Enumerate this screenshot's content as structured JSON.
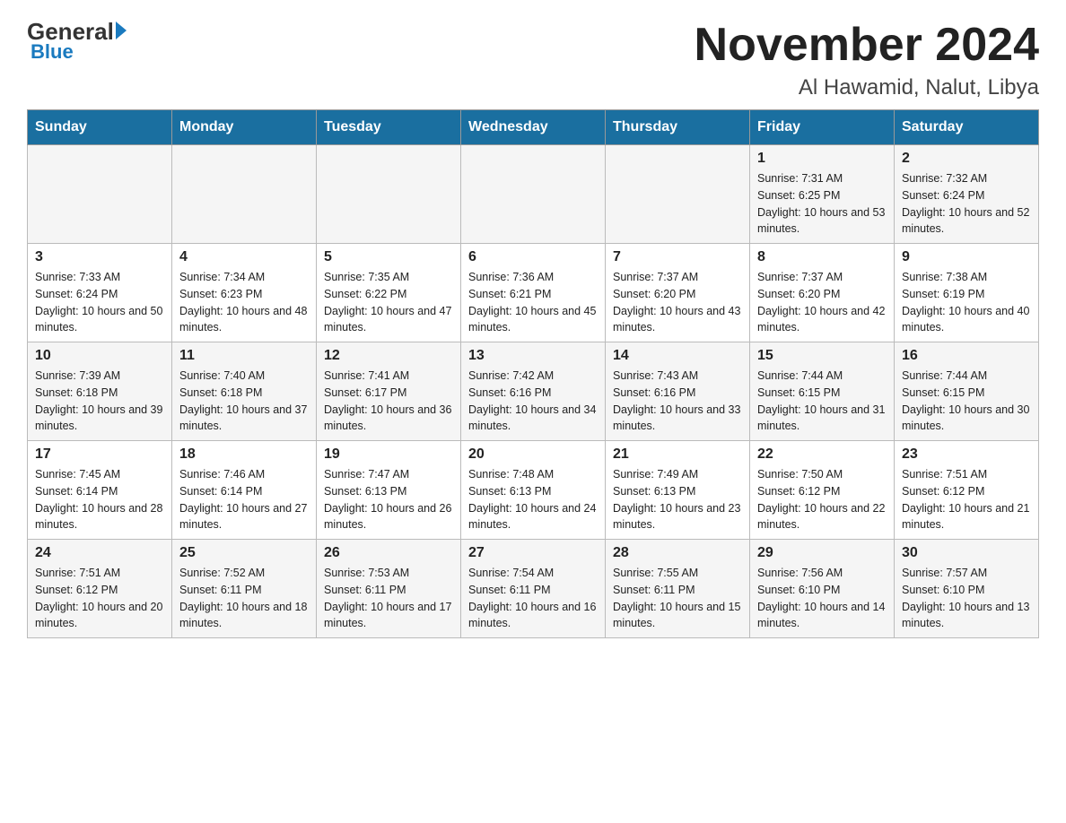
{
  "header": {
    "logo_general": "General",
    "logo_blue": "Blue",
    "month_title": "November 2024",
    "location": "Al Hawamid, Nalut, Libya"
  },
  "weekdays": [
    "Sunday",
    "Monday",
    "Tuesday",
    "Wednesday",
    "Thursday",
    "Friday",
    "Saturday"
  ],
  "weeks": [
    [
      {
        "day": "",
        "info": ""
      },
      {
        "day": "",
        "info": ""
      },
      {
        "day": "",
        "info": ""
      },
      {
        "day": "",
        "info": ""
      },
      {
        "day": "",
        "info": ""
      },
      {
        "day": "1",
        "info": "Sunrise: 7:31 AM\nSunset: 6:25 PM\nDaylight: 10 hours and 53 minutes."
      },
      {
        "day": "2",
        "info": "Sunrise: 7:32 AM\nSunset: 6:24 PM\nDaylight: 10 hours and 52 minutes."
      }
    ],
    [
      {
        "day": "3",
        "info": "Sunrise: 7:33 AM\nSunset: 6:24 PM\nDaylight: 10 hours and 50 minutes."
      },
      {
        "day": "4",
        "info": "Sunrise: 7:34 AM\nSunset: 6:23 PM\nDaylight: 10 hours and 48 minutes."
      },
      {
        "day": "5",
        "info": "Sunrise: 7:35 AM\nSunset: 6:22 PM\nDaylight: 10 hours and 47 minutes."
      },
      {
        "day": "6",
        "info": "Sunrise: 7:36 AM\nSunset: 6:21 PM\nDaylight: 10 hours and 45 minutes."
      },
      {
        "day": "7",
        "info": "Sunrise: 7:37 AM\nSunset: 6:20 PM\nDaylight: 10 hours and 43 minutes."
      },
      {
        "day": "8",
        "info": "Sunrise: 7:37 AM\nSunset: 6:20 PM\nDaylight: 10 hours and 42 minutes."
      },
      {
        "day": "9",
        "info": "Sunrise: 7:38 AM\nSunset: 6:19 PM\nDaylight: 10 hours and 40 minutes."
      }
    ],
    [
      {
        "day": "10",
        "info": "Sunrise: 7:39 AM\nSunset: 6:18 PM\nDaylight: 10 hours and 39 minutes."
      },
      {
        "day": "11",
        "info": "Sunrise: 7:40 AM\nSunset: 6:18 PM\nDaylight: 10 hours and 37 minutes."
      },
      {
        "day": "12",
        "info": "Sunrise: 7:41 AM\nSunset: 6:17 PM\nDaylight: 10 hours and 36 minutes."
      },
      {
        "day": "13",
        "info": "Sunrise: 7:42 AM\nSunset: 6:16 PM\nDaylight: 10 hours and 34 minutes."
      },
      {
        "day": "14",
        "info": "Sunrise: 7:43 AM\nSunset: 6:16 PM\nDaylight: 10 hours and 33 minutes."
      },
      {
        "day": "15",
        "info": "Sunrise: 7:44 AM\nSunset: 6:15 PM\nDaylight: 10 hours and 31 minutes."
      },
      {
        "day": "16",
        "info": "Sunrise: 7:44 AM\nSunset: 6:15 PM\nDaylight: 10 hours and 30 minutes."
      }
    ],
    [
      {
        "day": "17",
        "info": "Sunrise: 7:45 AM\nSunset: 6:14 PM\nDaylight: 10 hours and 28 minutes."
      },
      {
        "day": "18",
        "info": "Sunrise: 7:46 AM\nSunset: 6:14 PM\nDaylight: 10 hours and 27 minutes."
      },
      {
        "day": "19",
        "info": "Sunrise: 7:47 AM\nSunset: 6:13 PM\nDaylight: 10 hours and 26 minutes."
      },
      {
        "day": "20",
        "info": "Sunrise: 7:48 AM\nSunset: 6:13 PM\nDaylight: 10 hours and 24 minutes."
      },
      {
        "day": "21",
        "info": "Sunrise: 7:49 AM\nSunset: 6:13 PM\nDaylight: 10 hours and 23 minutes."
      },
      {
        "day": "22",
        "info": "Sunrise: 7:50 AM\nSunset: 6:12 PM\nDaylight: 10 hours and 22 minutes."
      },
      {
        "day": "23",
        "info": "Sunrise: 7:51 AM\nSunset: 6:12 PM\nDaylight: 10 hours and 21 minutes."
      }
    ],
    [
      {
        "day": "24",
        "info": "Sunrise: 7:51 AM\nSunset: 6:12 PM\nDaylight: 10 hours and 20 minutes."
      },
      {
        "day": "25",
        "info": "Sunrise: 7:52 AM\nSunset: 6:11 PM\nDaylight: 10 hours and 18 minutes."
      },
      {
        "day": "26",
        "info": "Sunrise: 7:53 AM\nSunset: 6:11 PM\nDaylight: 10 hours and 17 minutes."
      },
      {
        "day": "27",
        "info": "Sunrise: 7:54 AM\nSunset: 6:11 PM\nDaylight: 10 hours and 16 minutes."
      },
      {
        "day": "28",
        "info": "Sunrise: 7:55 AM\nSunset: 6:11 PM\nDaylight: 10 hours and 15 minutes."
      },
      {
        "day": "29",
        "info": "Sunrise: 7:56 AM\nSunset: 6:10 PM\nDaylight: 10 hours and 14 minutes."
      },
      {
        "day": "30",
        "info": "Sunrise: 7:57 AM\nSunset: 6:10 PM\nDaylight: 10 hours and 13 minutes."
      }
    ]
  ]
}
